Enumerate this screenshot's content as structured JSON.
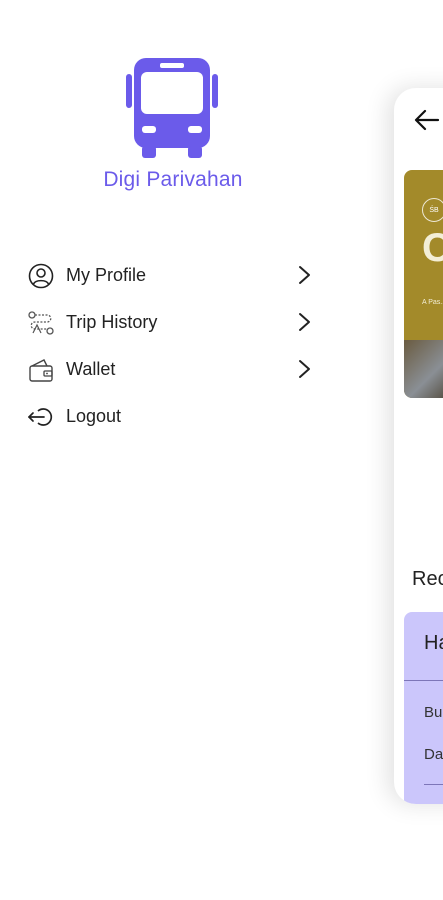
{
  "app": {
    "name": "Digi Parivahan",
    "brand_color": "#6b5bea"
  },
  "drawer": {
    "items": [
      {
        "label": "My Profile",
        "icon": "user-circle-icon",
        "has_chevron": true
      },
      {
        "label": "Trip History",
        "icon": "route-icon",
        "has_chevron": true
      },
      {
        "label": "Wallet",
        "icon": "wallet-icon",
        "has_chevron": true
      },
      {
        "label": "Logout",
        "icon": "logout-icon",
        "has_chevron": false
      }
    ]
  },
  "main": {
    "banner": {
      "badge": "ŚB",
      "headline": "C",
      "caption": "A Pas... and c..."
    },
    "section_title": "Rec",
    "recent_card": {
      "heading": "Ha",
      "row1": "Bu",
      "row2": "Da"
    }
  }
}
